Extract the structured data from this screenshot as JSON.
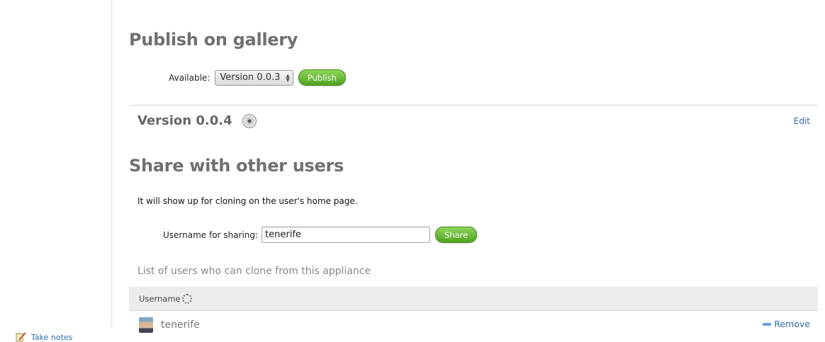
{
  "sidebar": {
    "take_notes_label": "Take notes"
  },
  "publish": {
    "title": "Publish on gallery",
    "available_label": "Available:",
    "version_select_value": "Version 0.0.3",
    "publish_button_label": "Publish"
  },
  "version_section": {
    "title": "Version 0.0.4",
    "edit_label": "Edit"
  },
  "share": {
    "title": "Share with other users",
    "hint": "It will show up for cloning on the user's home page.",
    "username_label": "Username for sharing:",
    "username_value": "tenerife",
    "share_button_label": "Share",
    "list_caption": "List of users who can clone from this appliance",
    "table": {
      "column_header": "Username",
      "rows": [
        {
          "username": "tenerife",
          "action_label": "Remove"
        }
      ]
    }
  }
}
